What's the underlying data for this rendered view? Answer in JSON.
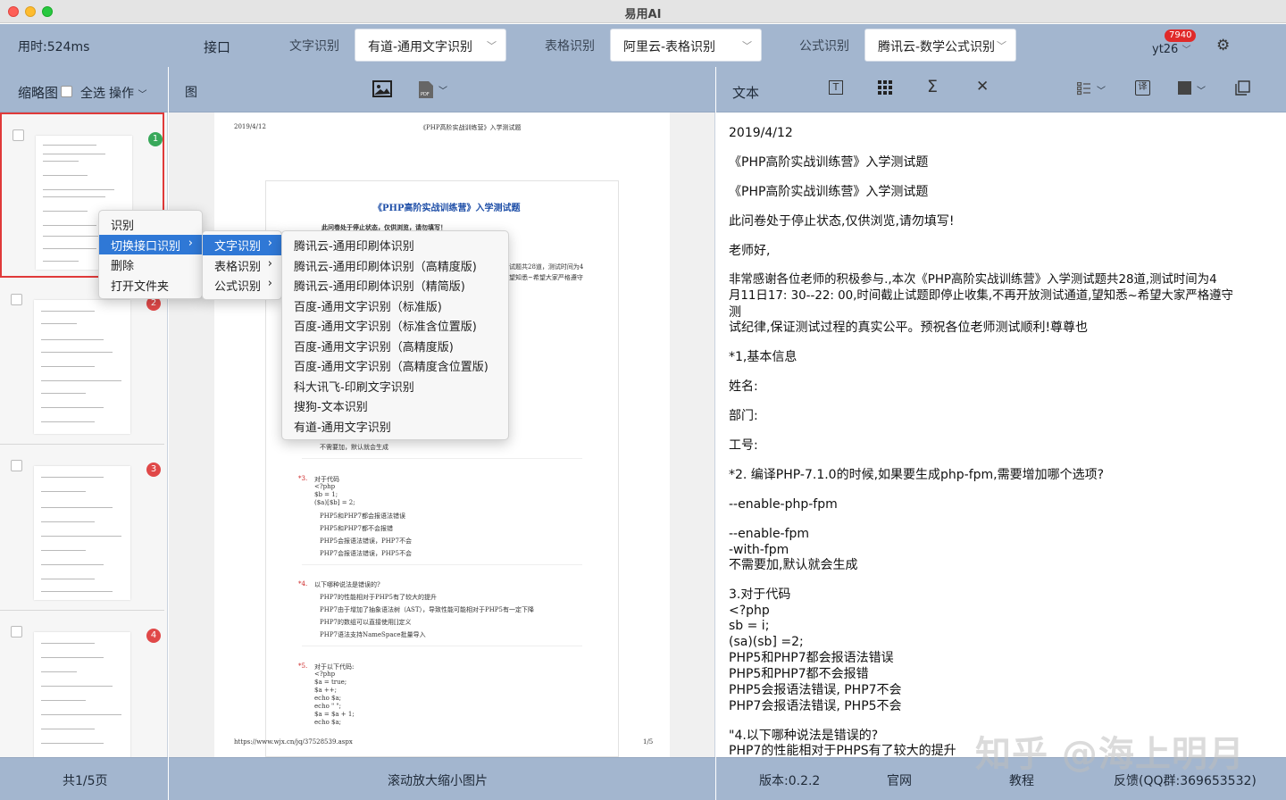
{
  "window": {
    "title": "易用AI"
  },
  "topbar": {
    "elapsed": "用时:524ms",
    "api_label": "接口",
    "text_ocr_label": "文字识别",
    "text_ocr_value": "有道-通用文字识别",
    "table_ocr_label": "表格识别",
    "table_ocr_value": "阿里云-表格识别",
    "formula_label": "公式识别",
    "formula_value": "腾讯云-数学公式识别",
    "user": "yt26",
    "badge": "7940"
  },
  "left_toolbar": {
    "thumbnails": "缩略图",
    "select_all": "全选",
    "operations": "操作"
  },
  "mid_toolbar": {
    "image": "图"
  },
  "right_toolbar": {
    "text": "文本"
  },
  "thumbnails": [
    {
      "n": "1"
    },
    {
      "n": "2"
    },
    {
      "n": "3"
    },
    {
      "n": "4"
    }
  ],
  "context_menu": {
    "items": [
      "识别",
      "切换接口识别",
      "删除",
      "打开文件夹"
    ],
    "sub": [
      "文字识别",
      "表格识别",
      "公式识别"
    ],
    "engines": [
      "腾讯云-通用印刷体识别",
      "腾讯云-通用印刷体识别（高精度版)",
      "腾讯云-通用印刷体识别（精简版)",
      "百度-通用文字识别（标准版)",
      "百度-通用文字识别（标准含位置版)",
      "百度-通用文字识别（高精度版)",
      "百度-通用文字识别（高精度含位置版)",
      "科大讯飞-印刷文字识别",
      "搜狗-文本识别",
      "有道-通用文字识别"
    ]
  },
  "doc": {
    "date": "2019/4/12",
    "header": "《PHP高阶实战训练营》入学测试题",
    "title": "《PHP高阶实战训练营》入学测试题",
    "notice": "此问卷处于停止状态，仅供浏览，请勿填写！",
    "frag1": "试题共28道，测试时间为4",
    "frag2": "望知悉~希望大家严格遵守",
    "q2_last": "不需要加，默认就会生成",
    "q3": "对于代码",
    "q3_lines": [
      "<?php",
      "$b = 1;",
      "($a)[$b] = 2;"
    ],
    "q3_opts": [
      "PHP5和PHP7都会报语法错误",
      "PHP5和PHP7都不会报错",
      "PHP5会报语法错误，PHP7不会",
      "PHP7会报语法错误，PHP5不会"
    ],
    "q4": "以下哪种说法是错误的?",
    "q4_opts": [
      "PHP7的性能相对于PHP5有了较大的提升",
      "PHP7由于增加了抽象语法树（AST），导致性能可能相对于PHP5有一定下降",
      "PHP7的数组可以直接使用[]定义",
      "PHP7语法支持NameSpace批量导入"
    ],
    "q5": "对于以下代码:",
    "q5_lines": [
      "<?php",
      "$a = true;",
      "$a ++;",
      "echo $a;",
      "echo \" \";",
      "$a = $a + 1;",
      "echo $a;"
    ],
    "url": "https://www.wjx.cn/jq/37528539.aspx",
    "page": "1/5"
  },
  "result_lines": [
    "2019/4/12",
    "《PHP高阶实战训练营》入学测试题",
    "《PHP高阶实战训练营》入学测试题",
    "此问卷处于停止状态,仅供浏览,请勿填写!",
    "老师好,",
    "非常感谢各位老师的积极参与.,本次《PHP高阶实战训练营》入学测试题共28道,测试时间为4",
    "月11日17: 30--22: 00,时间截止试题即停止收集,不再开放测试通道,望知悉~希望大家严格遵守",
    "测",
    "试纪律,保证测试过程的真实公平。预祝各位老师测试顺利!尊尊也",
    "*1,基本信息",
    "姓名:",
    "部门:",
    "工号:",
    "*2. 编译PHP-7.1.0的时候,如果要生成php-fpm,需要增加哪个选项?",
    "--enable-php-fpm",
    "--enable-fpm",
    "-with-fpm",
    "不需要加,默认就会生成",
    "3.对于代码",
    "<?php",
    "sb = i;",
    "(sa)(sb] =2;",
    "PHP5和PHP7都会报语法错误",
    "PHP5和PHP7都不会报错",
    "PHP5会报语法错误, PHP7不会",
    "PHP7会报语法错误, PHP5不会",
    "\"4.以下哪种说法是错误的?",
    "PHP7的性能相对于PHPS有了较大的提升"
  ],
  "footer": {
    "pages": "共1/5页",
    "hint": "滚动放大缩小图片",
    "version": "版本:0.2.2",
    "site": "官网",
    "tutorial": "教程",
    "feedback": "反馈(QQ群:369653532)"
  },
  "watermark": "知乎 @海上明月"
}
